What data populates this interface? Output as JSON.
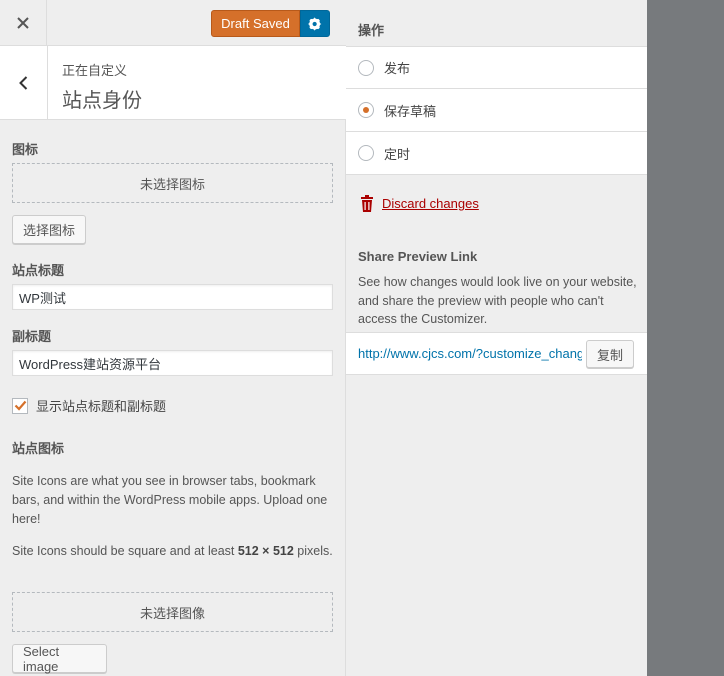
{
  "topbar": {
    "draft_label": "Draft Saved"
  },
  "section": {
    "subtitle": "正在自定义",
    "title": "站点身份"
  },
  "logo": {
    "label": "图标",
    "placeholder": "未选择图标",
    "button": "选择图标"
  },
  "site_title": {
    "label": "站点标题",
    "value": "WP测试"
  },
  "tagline": {
    "label": "副标题",
    "value": "WordPress建站资源平台"
  },
  "display_header": {
    "label": "显示站点标题和副标题",
    "checked": true
  },
  "site_icon": {
    "label": "站点图标",
    "desc1": "Site Icons are what you see in browser tabs, bookmark bars, and within the WordPress mobile apps. Upload one here!",
    "desc2_prefix": "Site Icons should be square and at least ",
    "desc2_size": "512 × 512",
    "desc2_suffix": " pixels.",
    "placeholder": "未选择图像",
    "button": "Select image"
  },
  "actions": {
    "title": "操作",
    "options": [
      {
        "label": "发布",
        "checked": false
      },
      {
        "label": "保存草稿",
        "checked": true
      },
      {
        "label": "定时",
        "checked": false
      }
    ],
    "discard": "Discard changes"
  },
  "share": {
    "title": "Share Preview Link",
    "desc": "See how changes would look live on your website, and share the preview with people who can't access the Customizer.",
    "link": "http://www.cjcs.com/?customize_changeset_uuid=",
    "copy": "复制"
  },
  "colors": {
    "accent_orange": "#d5702a",
    "primary_blue": "#0073aa",
    "danger_red": "#a00"
  }
}
